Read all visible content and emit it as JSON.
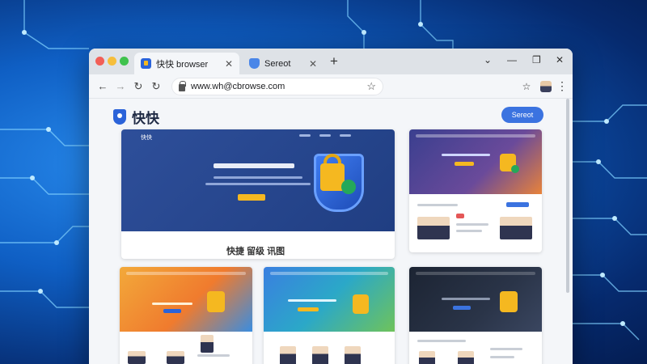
{
  "window": {
    "tabs": [
      {
        "label": "快快 browser",
        "active": true
      },
      {
        "label": "Sereot",
        "active": false
      }
    ]
  },
  "toolbar": {
    "url": "www.wh@cbrowse.com"
  },
  "page": {
    "logo_text": "快快",
    "header_button": "Sereot",
    "cards": [
      {
        "brand": "快快",
        "hero_style": "blue",
        "caption": "快捷 留级 讯图"
      },
      {
        "hero_style": "purple-orange"
      },
      {
        "hero_style": "orange"
      },
      {
        "hero_style": "green-blue"
      },
      {
        "hero_style": "dark"
      }
    ]
  },
  "colors": {
    "accent": "#3b73e0",
    "background_glow": "#2a8ef0",
    "background_dark": "#041d52",
    "lock_yellow": "#f5b820",
    "badge_green": "#25a85a"
  },
  "icons": [
    "back-arrow-icon",
    "forward-arrow-icon",
    "reload-icon",
    "lock-icon",
    "bookmark-star-icon",
    "extension-star-icon",
    "profile-avatar-icon",
    "kebab-menu-icon",
    "minimize-icon",
    "maximize-icon",
    "close-window-icon",
    "chevron-down-icon",
    "new-tab-icon"
  ]
}
